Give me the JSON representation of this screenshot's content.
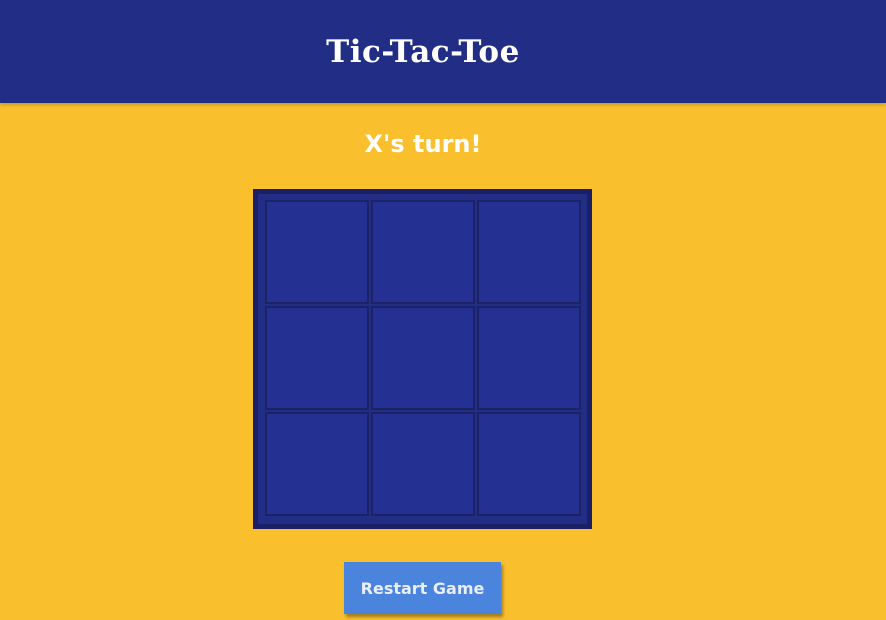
{
  "header": {
    "title": "Tic-Tac-Toe"
  },
  "status": {
    "turn_text": "X's turn!"
  },
  "board": {
    "cells": [
      "",
      "",
      "",
      "",
      "",
      "",
      "",
      "",
      ""
    ]
  },
  "controls": {
    "restart_label": "Restart Game"
  },
  "colors": {
    "background": "#f9bf2c",
    "header": "#222e85",
    "board": "#222e85",
    "cell": "#243092",
    "cell_border": "#1b2266",
    "button": "#4a84dc"
  }
}
